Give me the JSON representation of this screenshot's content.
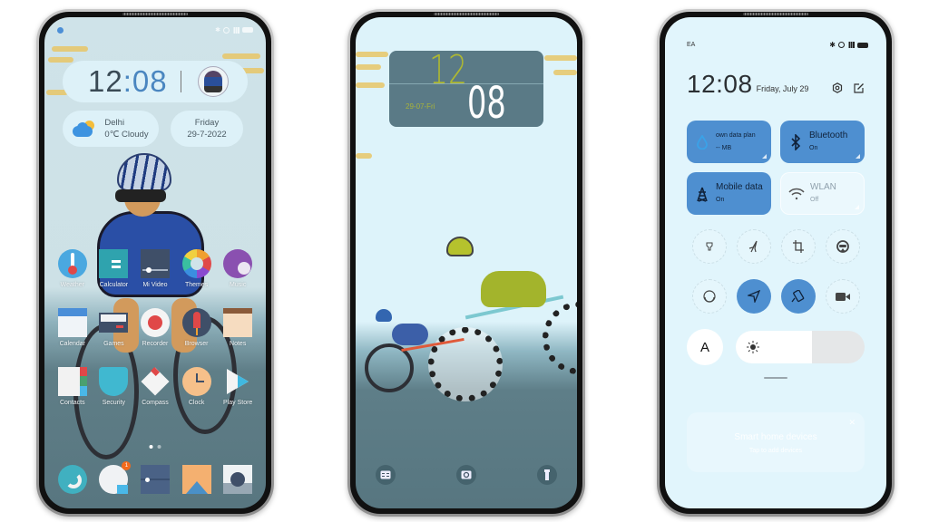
{
  "home_screen": {
    "clock": {
      "hour": "12",
      "minute": "08",
      "separator": ":"
    },
    "weather": {
      "city": "Delhi",
      "condition": "0℃  Cloudy"
    },
    "date": {
      "day": "Friday",
      "date": "29-7-2022"
    },
    "apps": [
      {
        "label": "Weather",
        "icon": "thermometer-icon"
      },
      {
        "label": "Calculator",
        "icon": "calculator-icon"
      },
      {
        "label": "Mi Video",
        "icon": "video-icon"
      },
      {
        "label": "Themes",
        "icon": "themes-icon"
      },
      {
        "label": "Music",
        "icon": "music-icon"
      },
      {
        "label": "Calendar",
        "icon": "calendar-icon"
      },
      {
        "label": "Games",
        "icon": "gamepad-icon"
      },
      {
        "label": "Recorder",
        "icon": "record-icon"
      },
      {
        "label": "Browser",
        "icon": "rocket-icon"
      },
      {
        "label": "Notes",
        "icon": "notes-icon"
      },
      {
        "label": "Contacts",
        "icon": "contacts-icon"
      },
      {
        "label": "Security",
        "icon": "shield-icon"
      },
      {
        "label": "Compass",
        "icon": "compass-icon"
      },
      {
        "label": "Clock",
        "icon": "clock-icon"
      },
      {
        "label": "Play Store",
        "icon": "play-store-icon"
      }
    ],
    "dock": [
      {
        "icon": "phone-icon"
      },
      {
        "icon": "messages-icon",
        "badge": "1"
      },
      {
        "icon": "browser-icon"
      },
      {
        "icon": "gallery-icon"
      },
      {
        "icon": "camera-icon"
      }
    ],
    "page_count": 2,
    "active_page": 1
  },
  "lock_screen": {
    "hour": "12",
    "minute": "08",
    "date": "29-07-Fri",
    "shortcuts": [
      {
        "icon": "remote-icon"
      },
      {
        "icon": "camera-icon"
      },
      {
        "icon": "flashlight-icon"
      }
    ]
  },
  "control_center": {
    "carrier": "EA",
    "time": "12:08",
    "date": "Friday, July 29",
    "tiles": [
      {
        "title": "own data plan",
        "subtitle": "-- MB",
        "active": true,
        "icon": "data-drop-icon"
      },
      {
        "title": "Bluetooth",
        "subtitle": "On",
        "active": true,
        "icon": "bluetooth-icon"
      },
      {
        "title": "Mobile data",
        "subtitle": "On",
        "active": true,
        "icon": "cell-tower-icon"
      },
      {
        "title": "WLAN",
        "subtitle": "Off",
        "active": false,
        "icon": "wifi-icon"
      }
    ],
    "toggles": [
      {
        "name": "flashlight",
        "active": false
      },
      {
        "name": "airplane-mode",
        "active": false
      },
      {
        "name": "screenshot",
        "active": false
      },
      {
        "name": "reading-mode",
        "active": false
      },
      {
        "name": "dark-mode",
        "active": false
      },
      {
        "name": "location",
        "active": true
      },
      {
        "name": "auto-rotate",
        "active": true
      },
      {
        "name": "screen-recorder",
        "active": false
      }
    ],
    "auto_brightness_label": "A",
    "brightness_percent": 59,
    "smart_home": {
      "title": "Smart home devices",
      "subtitle": "Tap to add devices"
    }
  }
}
